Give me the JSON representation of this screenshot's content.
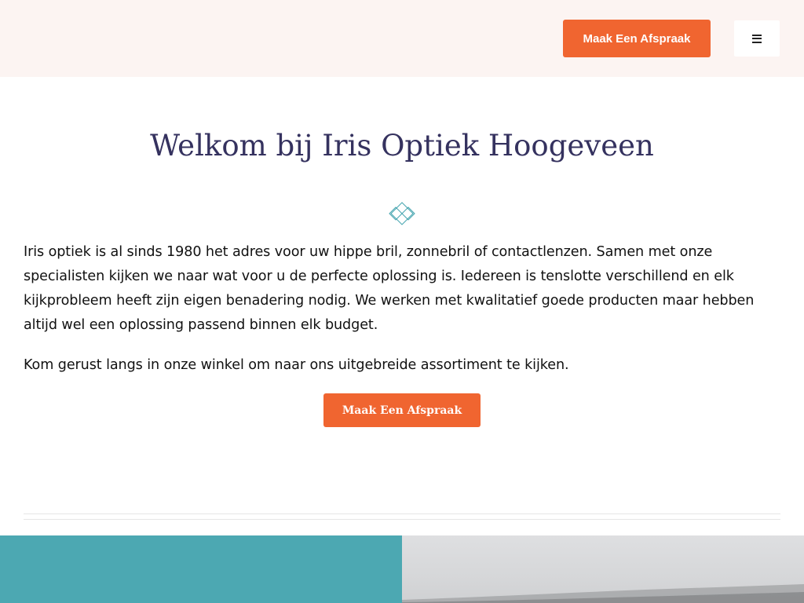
{
  "header": {
    "cta_label": "Maak Een Afspraak",
    "menu_icon": "hamburger-icon"
  },
  "main": {
    "title": "Welkom bij Iris Optiek Hoogeveen",
    "ornament_icon": "diamond-ornament-icon",
    "intro": "Iris optiek is al sinds 1980 het adres voor uw hippe bril, zonnebril of contactlenzen. Samen met onze specialisten kijken we naar wat voor u de perfecte oplossing is. Iedereen is tenslotte verschillend en elk kijkprobleem heeft zijn eigen benadering nodig. We werken met kwalitatief goede producten maar hebben altijd wel een oplossing passend binnen elk budget.",
    "visit": "Kom gerust langs in onze winkel om naar ons uitgebreide assortiment te kijken.",
    "cta_label": "Maak Een Afspraak"
  },
  "colors": {
    "header_bg": "#fcf4f2",
    "accent": "#f06530",
    "title": "#35325f",
    "ornament": "#4ca8b2",
    "teal_panel": "#4ca8b2"
  }
}
